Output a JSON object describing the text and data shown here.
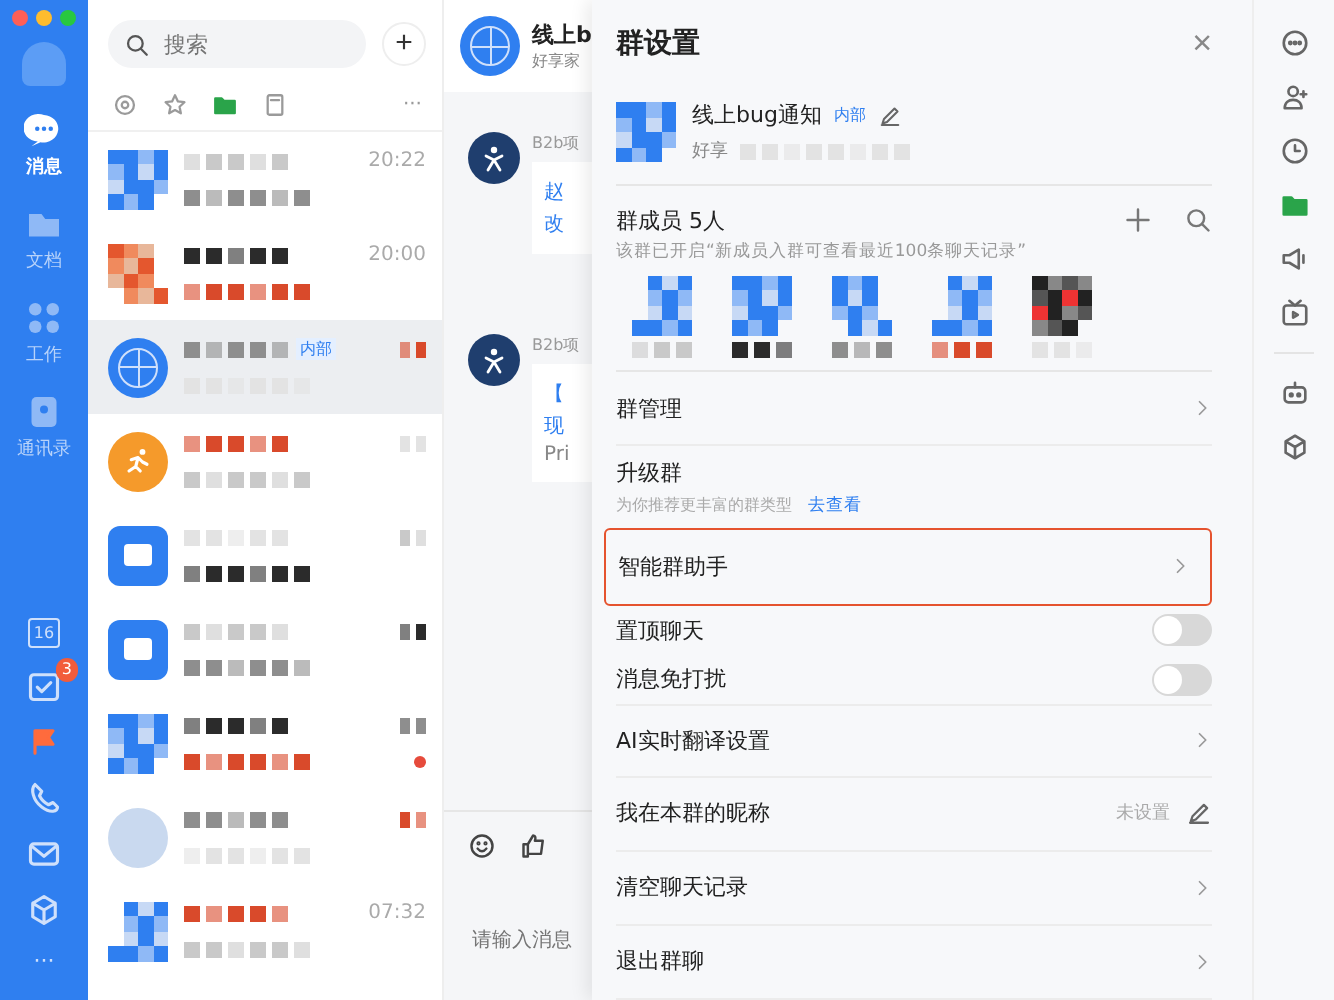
{
  "sidebar": {
    "nav": [
      {
        "label": "消息",
        "selected": true
      },
      {
        "label": "文档",
        "selected": false
      },
      {
        "label": "工作",
        "selected": false
      },
      {
        "label": "通讯录",
        "selected": false
      }
    ],
    "calendar_day": "16",
    "todo_badge": "3",
    "more": "···"
  },
  "chat_list": {
    "search": {
      "placeholder": "搜索"
    },
    "add": "+",
    "more": "···",
    "items": [
      {
        "time": "20:22",
        "selected": false,
        "unread": false
      },
      {
        "time": "20:00",
        "selected": false,
        "unread": false
      },
      {
        "tag": "内部",
        "selected": true,
        "unread": false
      },
      {
        "selected": false,
        "unread": false
      },
      {
        "selected": false,
        "unread": false
      },
      {
        "selected": false,
        "unread": false
      },
      {
        "selected": false,
        "unread": true
      },
      {
        "selected": false,
        "unread": false
      },
      {
        "time": "07:32",
        "selected": false,
        "unread": false
      }
    ]
  },
  "chat": {
    "title": "线上b",
    "subtitle": "好享家",
    "messages": [
      {
        "sender": "B2b项",
        "lines": [
          "赵",
          "改"
        ]
      },
      {
        "sender": "B2b项",
        "lines": [
          "【",
          "现",
          "Pri"
        ]
      }
    ],
    "input": {
      "placeholder": "请输入消息"
    }
  },
  "settings": {
    "title": "群设置",
    "close": "×",
    "group": {
      "name": "线上bug通知",
      "tag": "内部",
      "subtitle": "好享"
    },
    "members": {
      "title": "群成员 5人",
      "note": "该群已开启“新成员入群可查看最近100条聊天记录”"
    },
    "rows": [
      {
        "kind": "link",
        "label": "群管理",
        "highlighted": false
      },
      {
        "kind": "upgrade",
        "label": "升级群",
        "sub": "为你推荐更丰富的群类型",
        "action": "去查看",
        "highlighted": false
      },
      {
        "kind": "link",
        "label": "智能群助手",
        "highlighted": true
      },
      {
        "kind": "toggle",
        "label": "置顶聊天",
        "on": false,
        "highlighted": false
      },
      {
        "kind": "toggle",
        "label": "消息免打扰",
        "on": false,
        "highlighted": false
      },
      {
        "kind": "link",
        "label": "AI实时翻译设置",
        "highlighted": false
      },
      {
        "kind": "edit",
        "label": "我在本群的昵称",
        "value": "未设置",
        "highlighted": false
      },
      {
        "kind": "link",
        "label": "清空聊天记录",
        "highlighted": false
      },
      {
        "kind": "link",
        "label": "退出群聊",
        "highlighted": false
      }
    ]
  }
}
